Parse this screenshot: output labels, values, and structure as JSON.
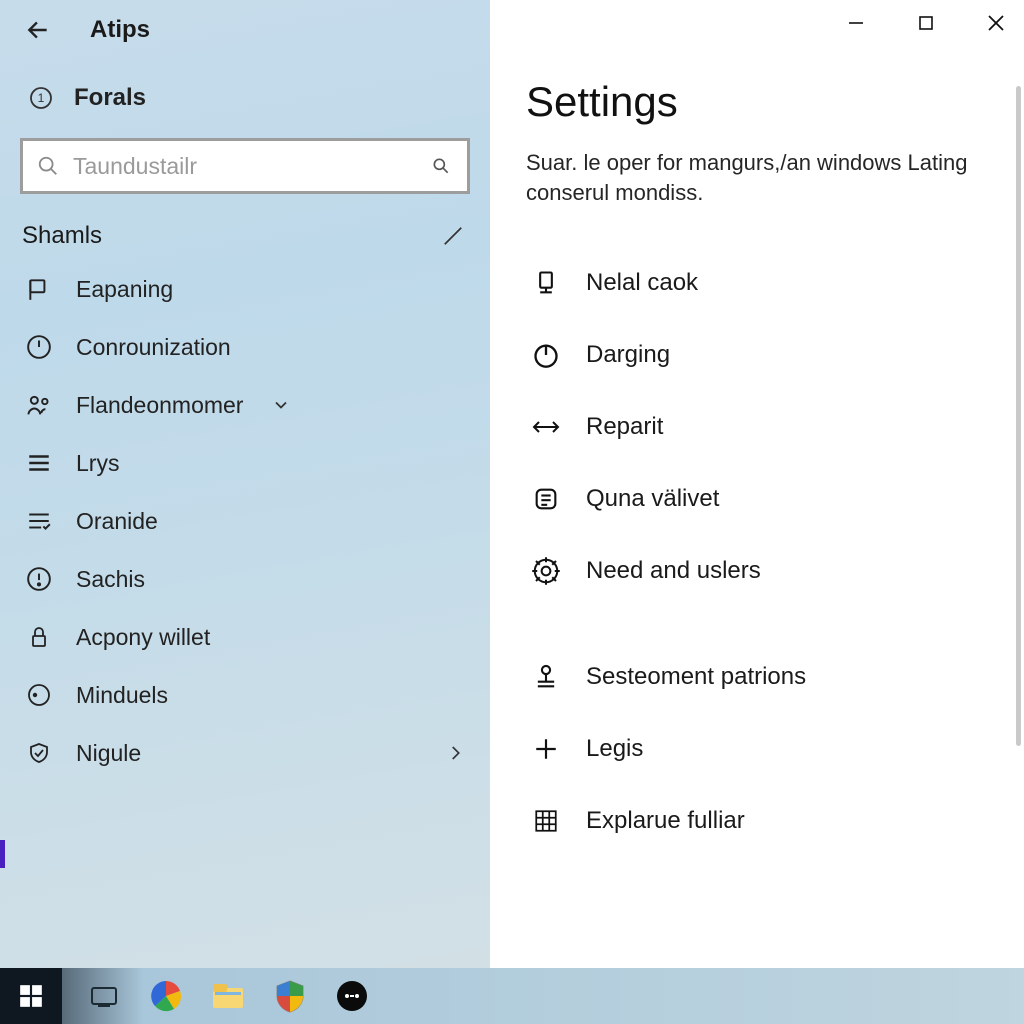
{
  "header": {
    "app_title": "Atips"
  },
  "sidebar": {
    "forals_label": "Forals",
    "search_placeholder": "Taundustailr",
    "section_label": "Shamls",
    "items": [
      {
        "label": "Eapaning"
      },
      {
        "label": "Conrounization"
      },
      {
        "label": "Flandeonmomer"
      },
      {
        "label": "Lrys"
      },
      {
        "label": "Oranide"
      },
      {
        "label": "Sachis"
      },
      {
        "label": "Acpony willet"
      },
      {
        "label": "Minduels"
      },
      {
        "label": "Nigule"
      }
    ]
  },
  "content": {
    "heading": "Settings",
    "subtitle": "Suar. le oper for mangurs,/an windows Lating conserul mondiss.",
    "items": [
      {
        "label": "Nelal caok"
      },
      {
        "label": "Darging"
      },
      {
        "label": "Reparit"
      },
      {
        "label": "Quna välivet"
      },
      {
        "label": "Need and uslers"
      },
      {
        "label": "Sesteoment patrions"
      },
      {
        "label": "Legis"
      },
      {
        "label": "Explarue fulliar"
      }
    ]
  }
}
